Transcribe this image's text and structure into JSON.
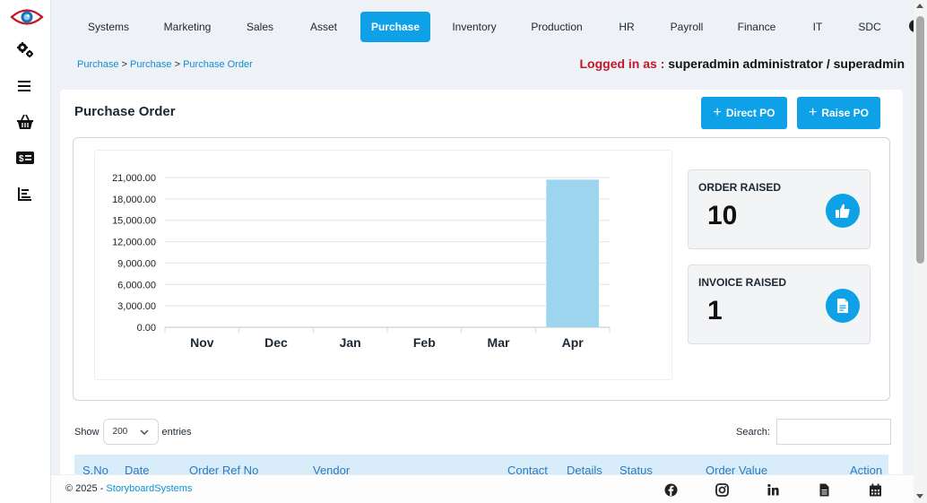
{
  "nav": {
    "items": [
      {
        "label": "Systems"
      },
      {
        "label": "Marketing"
      },
      {
        "label": "Sales"
      },
      {
        "label": "Asset"
      },
      {
        "label": "Purchase",
        "active": true
      },
      {
        "label": "Inventory"
      },
      {
        "label": "Production"
      },
      {
        "label": "HR"
      },
      {
        "label": "Payroll"
      },
      {
        "label": "Finance"
      },
      {
        "label": "IT"
      },
      {
        "label": "SDC"
      }
    ]
  },
  "sidebar": {
    "icons": [
      "eye-logo-icon",
      "gears-icon",
      "menu-icon",
      "basket-icon",
      "money-icon",
      "bar-chart-icon"
    ]
  },
  "breadcrumb": {
    "items": [
      "Purchase",
      "Purchase",
      "Purchase Order"
    ],
    "separator": ">"
  },
  "login": {
    "label": "Logged in as :",
    "user": "superadmin administrator / superadmin"
  },
  "page": {
    "title": "Purchase Order",
    "direct_po": "Direct PO",
    "raise_po": "Raise PO"
  },
  "stats": {
    "order_raised": {
      "label": "ORDER RAISED",
      "value": "10",
      "icon": "thumbs-up-icon"
    },
    "invoice_raised": {
      "label": "INVOICE RAISED",
      "value": "1",
      "icon": "invoice-icon"
    }
  },
  "chart_data": {
    "type": "bar",
    "categories": [
      "Nov",
      "Dec",
      "Jan",
      "Feb",
      "Mar",
      "Apr"
    ],
    "values": [
      0,
      0,
      0,
      0,
      0,
      20700
    ],
    "yticks": [
      "21,000.00",
      "18,000.00",
      "15,000.00",
      "12,000.00",
      "9,000.00",
      "6,000.00",
      "3,000.00",
      "0.00"
    ],
    "ylim": [
      0,
      21000
    ],
    "grid": true,
    "bar_color": "#9dd5ee"
  },
  "table": {
    "show_label": "Show",
    "entries_value": "200",
    "entries_label": "entries",
    "search_label": "Search:",
    "search_value": "",
    "columns": [
      "S.No",
      "Date",
      "Order Ref No",
      "Vendor",
      "Contact",
      "Details",
      "Status",
      "Order Value",
      "Action"
    ]
  },
  "footer": {
    "copyright": "© 2025 -",
    "company": "StoryboardSystems",
    "icons": [
      "facebook-icon",
      "instagram-icon",
      "linkedin-icon",
      "document-icon",
      "calendar-icon"
    ]
  },
  "colors": {
    "accent": "#0ea1e8",
    "login_label": "#c0182a",
    "link": "#0d8fd6"
  }
}
